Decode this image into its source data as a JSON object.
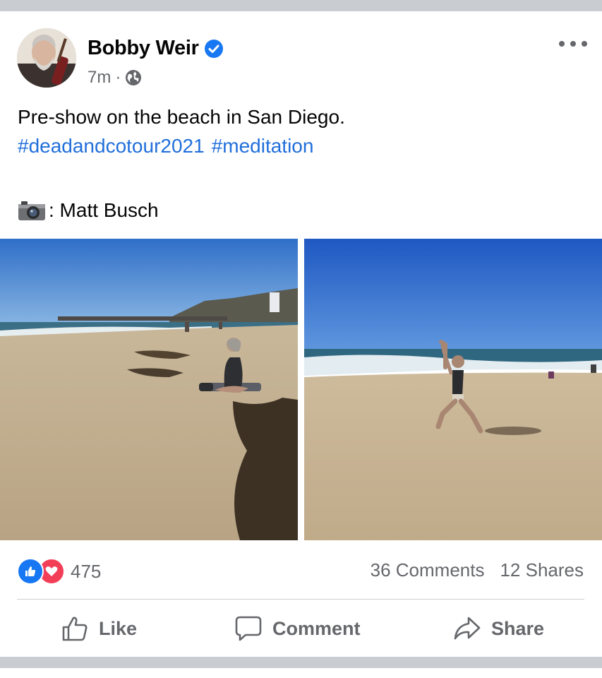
{
  "post": {
    "author": "Bobby Weir",
    "time": "7m",
    "separator": "·",
    "caption": "Pre-show on the beach in San Diego.",
    "hashtags": [
      "#deadandcotour2021",
      "#meditation"
    ],
    "credit": ": Matt Busch",
    "icons": {
      "verified": "verified-badge-icon",
      "audience": "globe-icon",
      "more": "more-options-icon",
      "camera": "camera-emoji"
    }
  },
  "engagement": {
    "reaction_count": "475",
    "comments": "36 Comments",
    "shares": "12 Shares"
  },
  "actions": {
    "like": "Like",
    "comment": "Comment",
    "share": "Share"
  },
  "colors": {
    "accent": "#1877f2",
    "hashtag": "#216fdb",
    "love": "#f33e58",
    "secondary_text": "#65676b"
  }
}
